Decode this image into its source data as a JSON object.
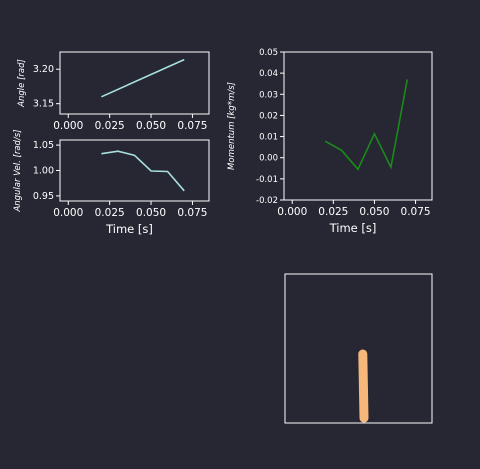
{
  "chart_data": [
    {
      "type": "line",
      "ylabel": "Angle [rad]",
      "xlim": [
        -0.005,
        0.085
      ],
      "ylim": [
        3.135,
        3.225
      ],
      "xticks": [
        "0.000",
        "0.025",
        "0.050",
        "0.075"
      ],
      "yticks": [
        "3.15",
        "3.20"
      ],
      "color": "#a8e0e0",
      "x": [
        0.02,
        0.07
      ],
      "y": [
        3.16,
        3.214
      ]
    },
    {
      "type": "line",
      "xlabel": "Time [s]",
      "ylabel": "Angular Vel. [rad/s]",
      "xlim": [
        -0.005,
        0.085
      ],
      "ylim": [
        0.94,
        1.06
      ],
      "xticks": [
        "0.000",
        "0.025",
        "0.050",
        "0.075"
      ],
      "yticks": [
        "0.95",
        "1.00",
        "1.05"
      ],
      "color": "#a8e0e0",
      "x": [
        0.02,
        0.03,
        0.04,
        0.05,
        0.06,
        0.07
      ],
      "y": [
        1.033,
        1.038,
        1.03,
        0.999,
        0.998,
        0.96
      ]
    },
    {
      "type": "line",
      "xlabel": "Time [s]",
      "ylabel": "Momentum [kg*m/s]",
      "xlim": [
        -0.005,
        0.085
      ],
      "ylim": [
        -0.02,
        0.05
      ],
      "xticks": [
        "0.000",
        "0.025",
        "0.050",
        "0.075"
      ],
      "yticks": [
        "-0.02",
        "-0.01",
        "0.00",
        "0.01",
        "0.02",
        "0.03",
        "0.04",
        "0.05"
      ],
      "color": "#1a8a1a",
      "x": [
        0.02,
        0.03,
        0.04,
        0.05,
        0.06,
        0.07
      ],
      "y": [
        0.0078,
        0.0035,
        -0.0055,
        0.0113,
        -0.0045,
        0.037
      ]
    }
  ],
  "pendulum": {
    "rod_color": "#f5b87a",
    "angle_rad": 3.16
  }
}
